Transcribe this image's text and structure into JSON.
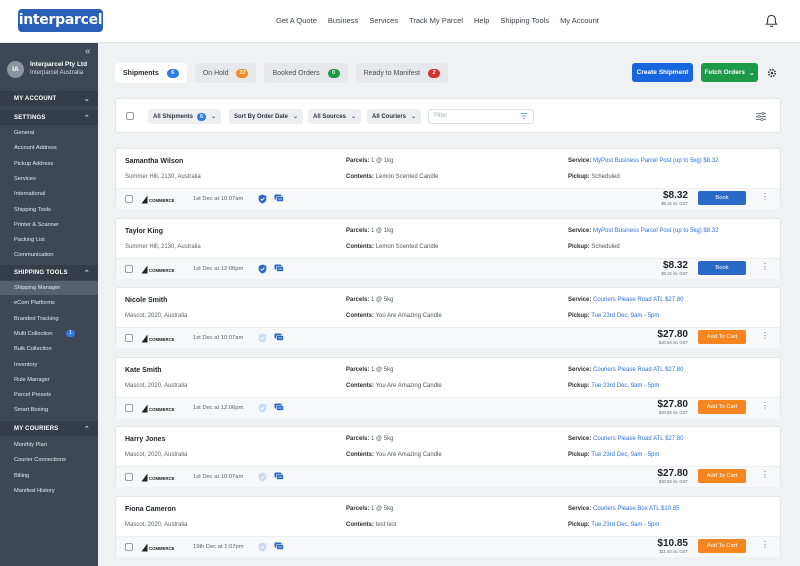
{
  "brand": {
    "logo_text": "interparcel",
    "primary": "#2a5fb8",
    "accent_blue": "#1865e0",
    "accent_green": "#1b9a47",
    "accent_orange": "#f5851f"
  },
  "nav": [
    "Get A Quote",
    "Business",
    "Services",
    "Track My Parcel",
    "Help",
    "Shipping Tools",
    "My Account"
  ],
  "account": {
    "initials": "IA",
    "name": "Interparcel Pty Ltd",
    "sub": "Interparcel Australia"
  },
  "sidebar": {
    "my_account": "MY ACCOUNT",
    "settings": {
      "title": "SETTINGS",
      "items": [
        "General",
        "Account Address",
        "Pickup Address",
        "Services",
        "International",
        "Shipping Tools",
        "Printer & Scanner",
        "Packing List",
        "Communication"
      ]
    },
    "shipping_tools": {
      "title": "SHIPPING TOOLS",
      "items": [
        "Shipping Manager",
        "eCom Platforms",
        "Branded Tracking",
        "Multi Collection",
        "Bulk Collection",
        "Inventory",
        "Rule Manager",
        "Parcel Presets",
        "Smart Boxing"
      ],
      "multi_collection_badge": "1"
    },
    "my_couriers": {
      "title": "MY COURIERS",
      "items": [
        "Monthly Plan",
        "Courier Connections",
        "Billing",
        "Manifest History"
      ]
    }
  },
  "tabs": [
    {
      "label": "Shipments",
      "count": "6",
      "color": "#2f7de1"
    },
    {
      "label": "On Hold",
      "count": "32",
      "color": "#f08a24"
    },
    {
      "label": "Booked Orders",
      "count": "0",
      "color": "#1b9a47"
    },
    {
      "label": "Ready to Manifest",
      "count": "2",
      "color": "#d32f2f"
    }
  ],
  "actions": {
    "create": "Create Shipment",
    "fetch": "Fetch Orders"
  },
  "filters": {
    "all_shipments": "All Shipments",
    "all_shipments_count": "6",
    "sort": "Sort By Order Date",
    "sources": "All Sources",
    "couriers": "All Couriers",
    "placeholder": "Filter"
  },
  "labels": {
    "parcels": "Parcels:",
    "contents": "Contents:",
    "service": "Service:",
    "pickup": "Pickup:",
    "source": "COMMERCE"
  },
  "shipments": [
    {
      "name": "Samantha Wilson",
      "address": "Summer Hill, 2130, Australia",
      "parcels": "1 @ 1kg",
      "contents": "Lemon Scented Candle",
      "service": "MyPost Business Parcel Post (up to 5kg) $8.32",
      "pickup": "Scheduled",
      "pickup_blue": false,
      "date": "1st Dec at 10:07am",
      "verified": true,
      "price": "$8.32",
      "price_inc": "$9.15 inc GST",
      "action": "Book",
      "action_type": "book"
    },
    {
      "name": "Taylor King",
      "address": "Summer Hill, 2130, Australia",
      "parcels": "1 @ 1kg",
      "contents": "Lemon Scented Candle",
      "service": "MyPost Business Parcel Post (up to 5kg) $8.32",
      "pickup": "Scheduled",
      "pickup_blue": false,
      "date": "1st Dec at 12:06pm",
      "verified": true,
      "price": "$8.32",
      "price_inc": "$9.15 inc GST",
      "action": "Book",
      "action_type": "book"
    },
    {
      "name": "Nicole Smith",
      "address": "Mascot, 2020, Australia",
      "parcels": "1 @ 5kg",
      "contents": "You Are Amazing Candle",
      "service": "Couriers Please Road ATL $27.80",
      "pickup": "Tue 23rd Dec, 9am - 5pm",
      "pickup_blue": true,
      "date": "1st Dec at 10:07am",
      "verified": false,
      "price": "$27.80",
      "price_inc": "$30.58 inc GST",
      "action": "Add To Cart",
      "action_type": "cart"
    },
    {
      "name": "Kate Smith",
      "address": "Mascot, 2020, Australia",
      "parcels": "1 @ 5kg",
      "contents": "You Are Amazing Candle",
      "service": "Couriers Please Road ATL $27.80",
      "pickup": "Tue 23rd Dec, 9am - 5pm",
      "pickup_blue": true,
      "date": "1st Dec at 12:06pm",
      "verified": false,
      "price": "$27.80",
      "price_inc": "$30.58 inc GST",
      "action": "Add To Cart",
      "action_type": "cart"
    },
    {
      "name": "Harry Jones",
      "address": "Mascot, 2020, Australia",
      "parcels": "1 @ 5kg",
      "contents": "You Are Amazing Candle",
      "service": "Couriers Please Road ATL $27.80",
      "pickup": "Tue 23rd Dec, 9am - 5pm",
      "pickup_blue": true,
      "date": "1st Dec at 10:07am",
      "verified": false,
      "price": "$27.80",
      "price_inc": "$30.58 inc GST",
      "action": "Add To Cart",
      "action_type": "cart"
    },
    {
      "name": "Fiona Cameron",
      "address": "Mascot, 2020, Australia",
      "parcels": "1 @ 5kg",
      "contents": "test test",
      "service": "Couriers Please Box ATL $10.85",
      "pickup": "Tue 23rd Dec, 9am - 5pm",
      "pickup_blue": true,
      "date": "19th Dec at 1:07pm",
      "verified": false,
      "price": "$10.85",
      "price_inc": "$11.93 inc GST",
      "action": "Add To Cart",
      "action_type": "cart"
    }
  ]
}
